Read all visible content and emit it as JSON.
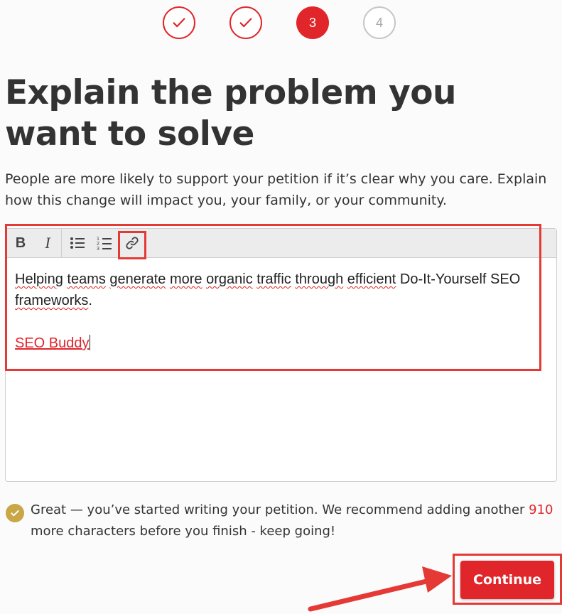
{
  "stepper": {
    "steps": [
      {
        "state": "done",
        "icon": "check-icon"
      },
      {
        "state": "done",
        "icon": "check-icon"
      },
      {
        "state": "current",
        "label": "3"
      },
      {
        "state": "future",
        "label": "4"
      }
    ]
  },
  "page": {
    "title": "Explain the problem you want to solve",
    "description": "People are more likely to support your petition if it’s clear why you care. Explain how this change will impact you, your family, or your community."
  },
  "editor": {
    "toolbar": [
      "bold-icon",
      "italic-icon",
      "bulleted-list-icon",
      "numbered-list-icon",
      "link-icon"
    ],
    "content": {
      "paragraph1_words": [
        "Helping",
        "teams",
        "generate",
        "more",
        "organic",
        "traffic",
        "through",
        "efficient"
      ],
      "paragraph1_rest": "Do-It-Yourself SEO",
      "paragraph1_last": "frameworks",
      "paragraph1_end": ".",
      "link_text": "SEO Buddy"
    }
  },
  "hint": {
    "icon": "check-circle-icon",
    "prefix": "Great — you’ve started writing your petition. We recommend adding another ",
    "count": "910",
    "suffix": " more characters before you finish - keep going!"
  },
  "actions": {
    "continue_label": "Continue"
  },
  "colors": {
    "accent": "#e0262a",
    "annotation": "#e53935",
    "hint_icon": "#c9a646",
    "future_step": "#c6c6c6"
  }
}
